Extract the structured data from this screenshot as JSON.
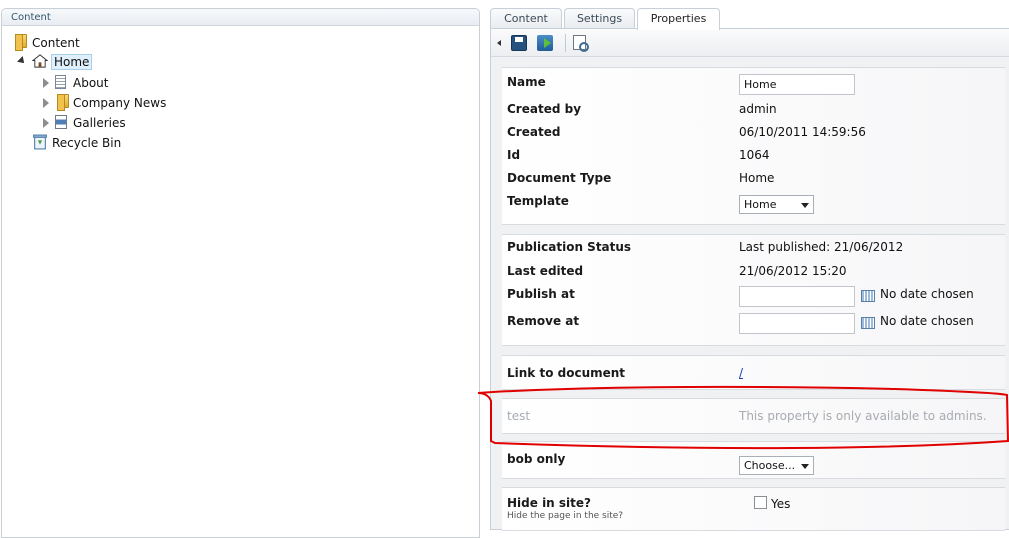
{
  "tree": {
    "header": "Content",
    "items": [
      {
        "label": "Content",
        "icon": "folder-icon"
      },
      {
        "label": "Home",
        "icon": "home-icon"
      },
      {
        "label": "About",
        "icon": "document-icon"
      },
      {
        "label": "Company News",
        "icon": "folder-icon"
      },
      {
        "label": "Galleries",
        "icon": "gallery-icon"
      },
      {
        "label": "Recycle Bin",
        "icon": "recycle-bin-icon"
      }
    ]
  },
  "tabs": [
    {
      "label": "Content",
      "active": false
    },
    {
      "label": "Settings",
      "active": false
    },
    {
      "label": "Properties",
      "active": true
    }
  ],
  "toolbar": {
    "icons": [
      "collapse-arrow-icon",
      "save-icon",
      "save-and-publish-icon",
      "preview-icon"
    ]
  },
  "properties": {
    "name": {
      "label": "Name",
      "value": "Home"
    },
    "created_by": {
      "label": "Created by",
      "value": "admin"
    },
    "created": {
      "label": "Created",
      "value": "06/10/2011 14:59:56"
    },
    "id": {
      "label": "Id",
      "value": "1064"
    },
    "document_type": {
      "label": "Document Type",
      "value": "Home"
    },
    "template": {
      "label": "Template",
      "value": "Home"
    }
  },
  "publication": {
    "status": {
      "label": "Publication Status",
      "value": "Last published: 21/06/2012"
    },
    "last_edited": {
      "label": "Last edited",
      "value": "21/06/2012 15:20"
    },
    "publish_at": {
      "label": "Publish at",
      "value": "",
      "note": "No date chosen"
    },
    "remove_at": {
      "label": "Remove at",
      "value": "",
      "note": "No date chosen"
    }
  },
  "link": {
    "label": "Link to document",
    "value": "/"
  },
  "test_property": {
    "label": "test",
    "message": "This property is only available to admins."
  },
  "bob_only": {
    "label": "bob only",
    "value": "Choose..."
  },
  "hide_in_site": {
    "label": "Hide in site?",
    "description": "Hide the page in the site?",
    "checkbox_label": "Yes",
    "checked": false
  },
  "colors": {
    "annotation": "#e00000",
    "link": "#1a43b5",
    "tree_selection": "#dfeffb"
  }
}
